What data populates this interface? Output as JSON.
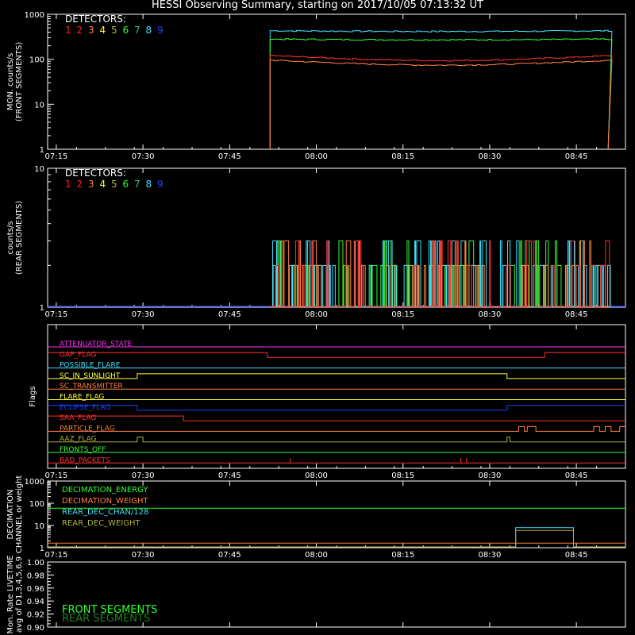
{
  "title": "HESSI Observing Summary, starting on 2017/10/05 07:13:32 UT",
  "time_ticks": [
    "07:15",
    "07:30",
    "07:45",
    "08:00",
    "08:15",
    "08:30",
    "08:45"
  ],
  "colors": {
    "axes": "#ffffff",
    "det": [
      "#ff2020",
      "#ff2020",
      "#ff7f30",
      "#ffff40",
      "#b0b040",
      "#30ff30",
      "#30c0a0",
      "#40e0ff",
      "#2040ff"
    ]
  },
  "chart_data": [
    {
      "type": "line",
      "id": "front",
      "ylabel1": "MON. counts/s",
      "ylabel2": "(FRONT SEGMENTS)",
      "yscale": "log",
      "ylim": [
        1,
        1000
      ],
      "yticks": [
        "1",
        "10",
        "100",
        "1000"
      ],
      "xlim_minutes": [
        0,
        100
      ],
      "legend_title": "DETECTORS:",
      "legend_digits": [
        "1",
        "2",
        "3",
        "4",
        "5",
        "6",
        "7",
        "8",
        "9"
      ],
      "series": [
        {
          "detector": "8",
          "color": "#40e0ff",
          "start_min": 38.5,
          "end_min": 97.0,
          "level": 430
        },
        {
          "detector": "6",
          "color": "#30ff30",
          "start_min": 38.5,
          "end_min": 97.0,
          "level": 280
        },
        {
          "detector": "1",
          "color": "#ff3030",
          "start_min": 38.5,
          "end_min": 97.0,
          "level": 120
        },
        {
          "detector": "3",
          "color": "#ff8040",
          "start_min": 38.5,
          "end_min": 97.0,
          "level": 95
        }
      ]
    },
    {
      "type": "line",
      "id": "rear",
      "ylabel1": "counts/s",
      "ylabel2": "(REAR SEGMENTS)",
      "yscale": "log",
      "ylim": [
        1,
        10
      ],
      "yticks": [
        "1",
        "10"
      ],
      "legend_title": "DETECTORS:",
      "legend_digits": [
        "1",
        "2",
        "3",
        "4",
        "5",
        "6",
        "7",
        "8",
        "9"
      ],
      "activity_start_min": 38.5,
      "activity_end_min": 97.0,
      "levels": [
        2,
        3
      ]
    },
    {
      "type": "flags",
      "id": "flags",
      "ylabel": "Flags",
      "flags": [
        {
          "name": "ATTENUATOR_STATE",
          "color": "#ff30ff",
          "segments": [
            [
              0,
              100,
              0
            ]
          ]
        },
        {
          "name": "GAP_FLAG",
          "color": "#ff3030",
          "segments": [
            [
              0,
              38,
              1
            ],
            [
              38,
              86,
              0
            ],
            [
              86,
              100,
              1
            ]
          ]
        },
        {
          "name": "POSSIBLE_FLARE",
          "color": "#40e0ff",
          "segments": [
            [
              0,
              100,
              0
            ]
          ]
        },
        {
          "name": "SC_IN_SUNLIGHT",
          "color": "#ffff40",
          "segments": [
            [
              0,
              15.5,
              0
            ],
            [
              15.5,
              79.5,
              1
            ],
            [
              79.5,
              100,
              0
            ]
          ]
        },
        {
          "name": "SC_TRANSMITTER",
          "color": "#ff8040",
          "segments": [
            [
              0,
              100,
              0
            ]
          ]
        },
        {
          "name": "FLARE_FLAG",
          "color": "#ffff40",
          "segments": [
            [
              0,
              100,
              0
            ]
          ]
        },
        {
          "name": "ECLIPSE_FLAG",
          "color": "#2040ff",
          "segments": [
            [
              0,
              15.5,
              1
            ],
            [
              15.5,
              79.5,
              0
            ],
            [
              79.5,
              82,
              1
            ],
            [
              82,
              100,
              1
            ]
          ]
        },
        {
          "name": "SAA_FLAG",
          "color": "#ff3030",
          "segments": [
            [
              0,
              23.5,
              1
            ],
            [
              23.5,
              100,
              0
            ]
          ]
        },
        {
          "name": "PARTICLE_FLAG",
          "color": "#ff8040",
          "segments": [
            [
              0,
              81.5,
              0
            ],
            [
              81.5,
              82.5,
              1
            ],
            [
              82.5,
              83,
              0
            ],
            [
              83,
              84.5,
              1
            ],
            [
              84.5,
              85,
              0
            ],
            [
              85,
              94.5,
              0
            ],
            [
              94.5,
              95.5,
              1
            ],
            [
              95.5,
              96.5,
              0
            ],
            [
              96.5,
              97.5,
              1
            ],
            [
              97.5,
              99,
              0
            ],
            [
              99,
              100,
              1
            ]
          ]
        },
        {
          "name": "AAZ_FLAG",
          "color": "#b0b040",
          "segments": [
            [
              0,
              15.5,
              0
            ],
            [
              15.5,
              16.5,
              1
            ],
            [
              16.5,
              79.5,
              0
            ],
            [
              79.5,
              80,
              1
            ],
            [
              80,
              100,
              0
            ]
          ]
        },
        {
          "name": "FRONTS_OFF",
          "color": "#30ff30",
          "segments": [
            [
              0,
              100,
              0
            ]
          ]
        },
        {
          "name": "BAD_PACKETS",
          "color": "#ff3030",
          "segments": [
            [
              0,
              100,
              0
            ]
          ]
        }
      ],
      "bad_packet_spikes_min": [
        42,
        71.5,
        72.5
      ]
    },
    {
      "type": "line",
      "id": "decimation",
      "ylabel1": "DECIMATION",
      "ylabel2": "CHANNEL or weight",
      "yscale": "log",
      "ylim": [
        1,
        1000
      ],
      "yticks": [
        "1",
        "10",
        "100",
        "1000"
      ],
      "legend": [
        {
          "name": "DECIMATION_ENERGY",
          "color": "#30ff30"
        },
        {
          "name": "DECIMATION_WEIGHT",
          "color": "#ff8040"
        },
        {
          "name": "REAR_DEC_CHAN/128",
          "color": "#40e0ff"
        },
        {
          "name": "REAR_DEC_WEIGHT",
          "color": "#b0b040"
        }
      ],
      "series": [
        {
          "name": "DECIMATION_ENERGY",
          "color": "#30ff30",
          "points": [
            [
              0,
              60
            ],
            [
              100,
              60
            ]
          ]
        },
        {
          "name": "DECIMATION_WEIGHT",
          "color": "#ff8040",
          "points": [
            [
              0,
              1.6
            ],
            [
              100,
              1.6
            ]
          ]
        },
        {
          "name": "REAR_DEC_CHAN/128",
          "color": "#40e0ff",
          "points": [
            [
              0,
              1
            ],
            [
              81,
              1
            ],
            [
              81,
              8
            ],
            [
              91,
              8
            ],
            [
              91,
              1
            ],
            [
              100,
              1
            ]
          ]
        },
        {
          "name": "REAR_DEC_WEIGHT",
          "color": "#b0b040",
          "points": [
            [
              0,
              1
            ],
            [
              81,
              1
            ],
            [
              81,
              6
            ],
            [
              91,
              6
            ],
            [
              91,
              1
            ],
            [
              100,
              1
            ]
          ]
        }
      ]
    },
    {
      "type": "line",
      "id": "livetime",
      "ylabel1": "Mon. Rate LIVETIME",
      "ylabel2": "avg of D1,3,4,5,6,9",
      "ylim": [
        0.9,
        1.0
      ],
      "yticks": [
        "0.90",
        "0.92",
        "0.94",
        "0.96",
        "0.98",
        "1.00"
      ],
      "legend": [
        {
          "name": "FRONT SEGMENTS",
          "color": "#30ff30"
        },
        {
          "name": "REAR SEGMENTS",
          "color": "#208020"
        }
      ]
    }
  ]
}
